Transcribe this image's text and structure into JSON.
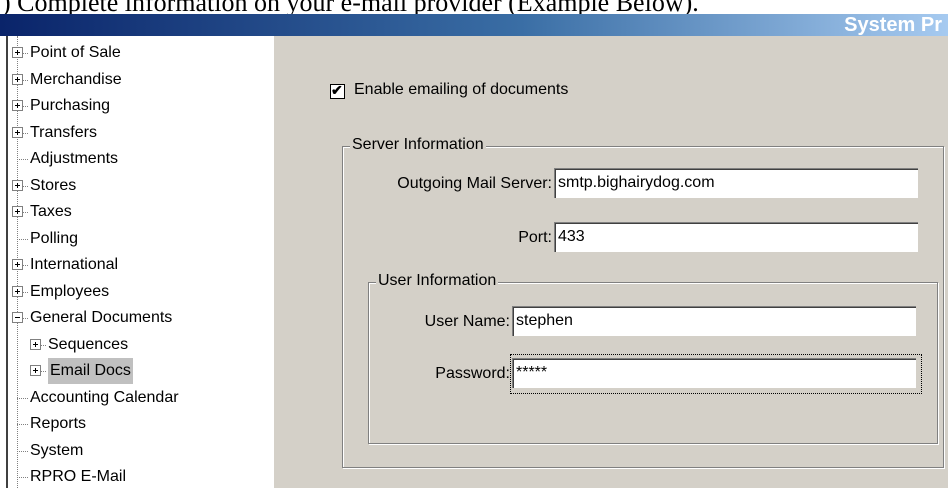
{
  "caption": ")  Complete information on your e-mail provider (Example Below).",
  "titlebar": {
    "title": "System Pr"
  },
  "tree": {
    "items": [
      {
        "label": "Point of Sale",
        "expander": "plus"
      },
      {
        "label": "Merchandise",
        "expander": "plus"
      },
      {
        "label": "Purchasing",
        "expander": "plus"
      },
      {
        "label": "Transfers",
        "expander": "plus"
      },
      {
        "label": "Adjustments",
        "expander": "none"
      },
      {
        "label": "Stores",
        "expander": "plus"
      },
      {
        "label": "Taxes",
        "expander": "plus"
      },
      {
        "label": "Polling",
        "expander": "none"
      },
      {
        "label": "International",
        "expander": "plus"
      },
      {
        "label": "Employees",
        "expander": "plus"
      },
      {
        "label": "General Documents",
        "expander": "minus"
      },
      {
        "label": "Sequences",
        "expander": "plus",
        "child": true
      },
      {
        "label": "Email Docs",
        "expander": "plus",
        "child": true,
        "selected": true
      },
      {
        "label": "Accounting Calendar",
        "expander": "none"
      },
      {
        "label": "Reports",
        "expander": "none"
      },
      {
        "label": "System",
        "expander": "none"
      },
      {
        "label": "RPRO E-Mail",
        "expander": "none"
      }
    ]
  },
  "email": {
    "enable_label": "Enable emailing of documents",
    "enable_checked": true,
    "enable_check_glyph": "✔",
    "server_group": "Server Information",
    "server_label": "Outgoing Mail Server:",
    "server_value": "smtp.bighairydog.com",
    "port_label": "Port:",
    "port_value": "433",
    "user_group": "User Information",
    "username_label": "User Name:",
    "username_value": "stephen",
    "password_label": "Password:",
    "password_value": "*****"
  }
}
